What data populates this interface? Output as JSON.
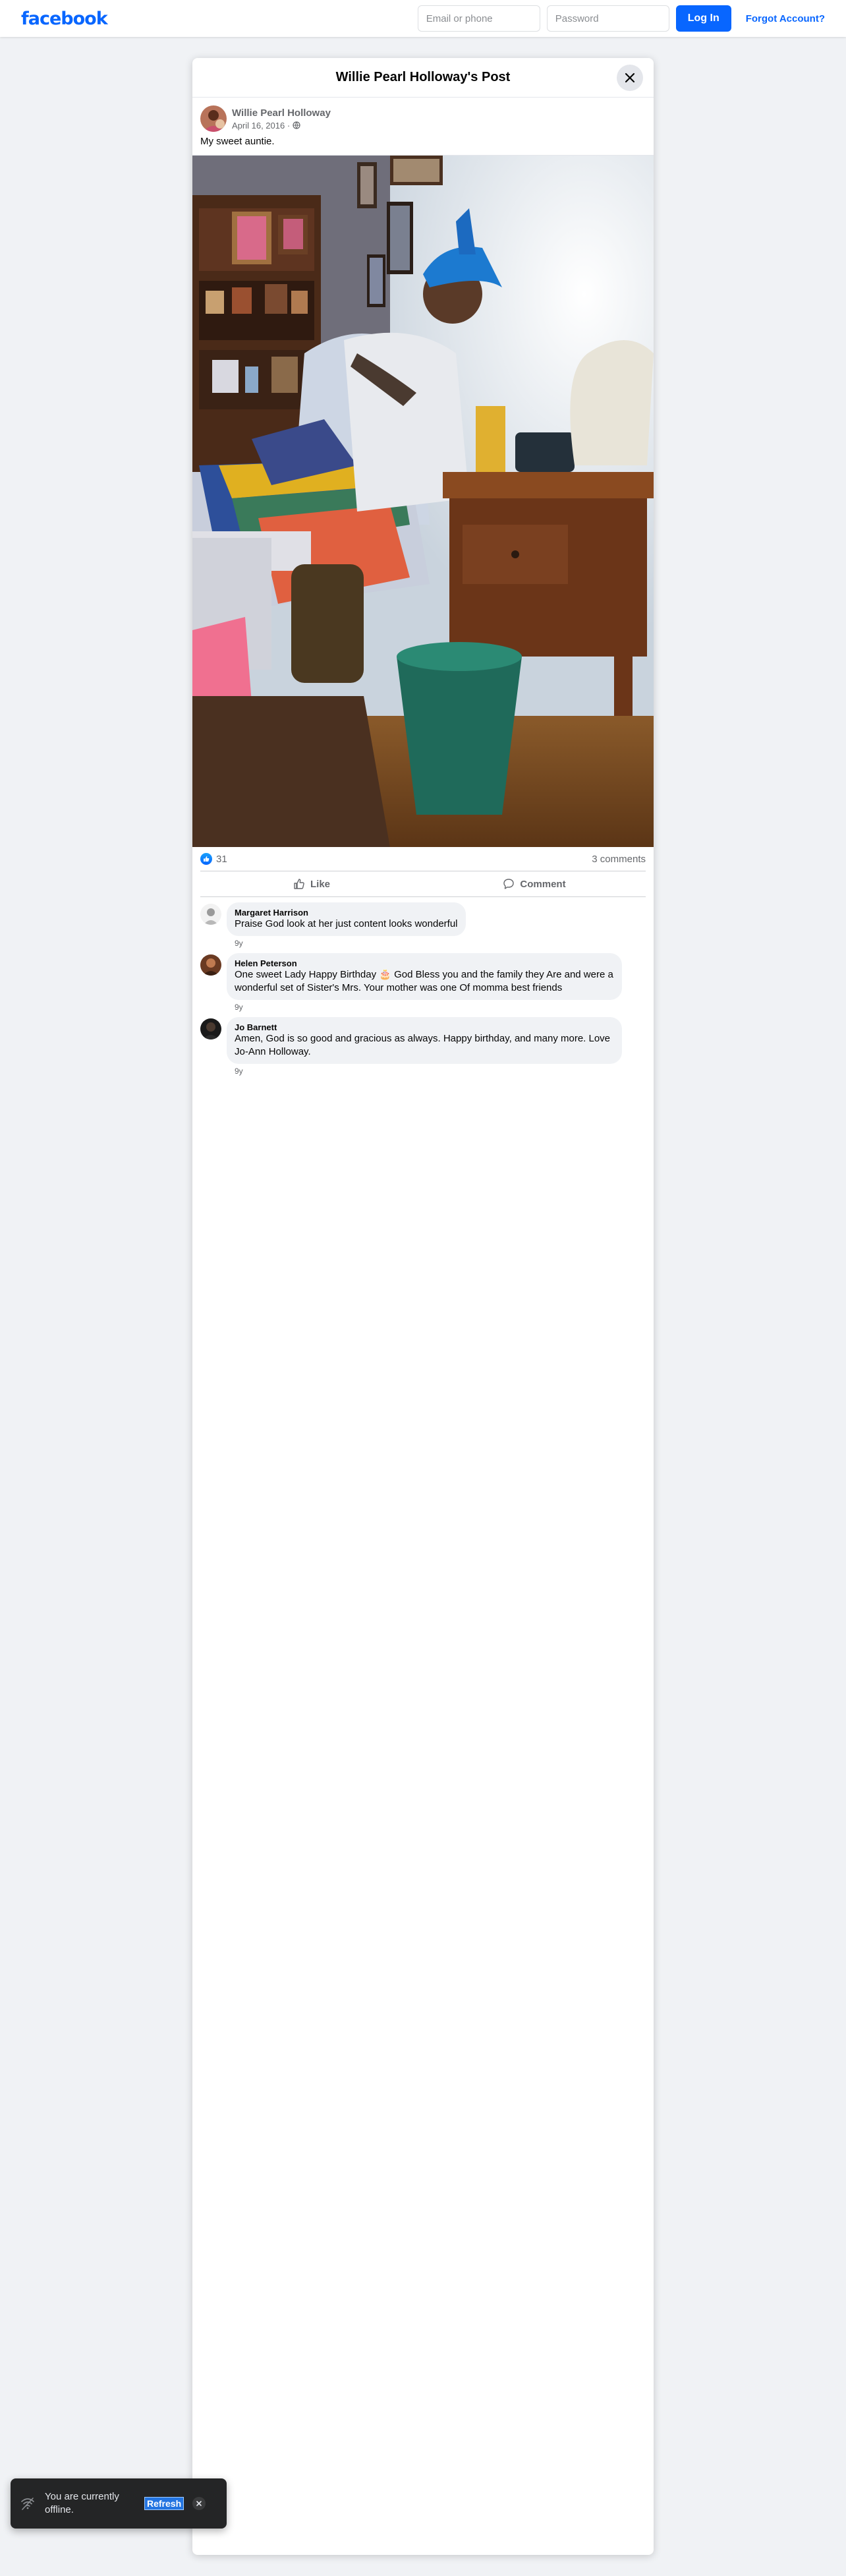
{
  "topbar": {
    "logo": "facebook",
    "email_placeholder": "Email or phone",
    "password_placeholder": "Password",
    "login_label": "Log In",
    "forgot_label": "Forgot Account?"
  },
  "post": {
    "title": "Willie Pearl Holloway's Post",
    "author": "Willie Pearl Holloway",
    "date": "April 16, 2016 ·",
    "privacy_icon": "globe-icon",
    "text": "My sweet auntie.",
    "likes": "31",
    "comments_count": "3 comments",
    "like_label": "Like",
    "comment_label": "Comment"
  },
  "comments": [
    {
      "name": "Margaret Harrison",
      "text": "Praise God look at her just content looks wonderful",
      "time": "9y"
    },
    {
      "name": "Helen Peterson",
      "text": "One sweet Lady Happy Birthday 🎂 God Bless you and the family they Are and were a wonderful set of Sister's Mrs. Your mother was one Of momma best friends",
      "time": "9y"
    },
    {
      "name": "Jo Barnett",
      "text": "Amen, God is so good and gracious as always. Happy birthday, and many more. Love Jo-Ann Holloway.",
      "time": "9y"
    }
  ],
  "toast": {
    "message": "You are currently offline.",
    "refresh_label": "Refresh",
    "icon": "wifi-off-icon"
  },
  "colors": {
    "brand": "#0866ff",
    "background": "#f0f2f5",
    "toast": "#242526"
  }
}
